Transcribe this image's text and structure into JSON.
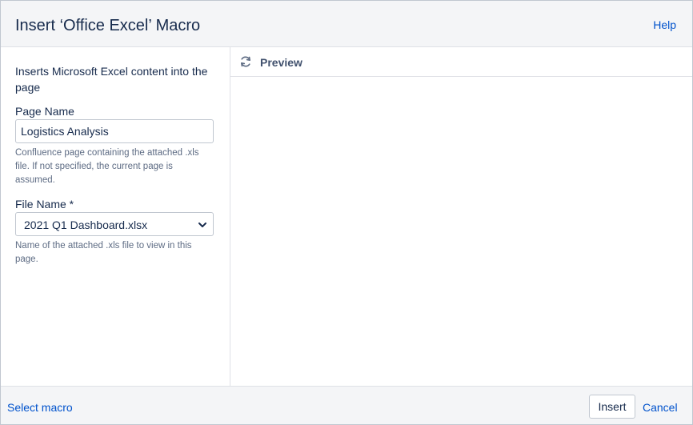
{
  "dialog": {
    "title": "Insert ‘Office Excel’ Macro",
    "help_label": "Help"
  },
  "left_panel": {
    "description": "Inserts Microsoft Excel content into the page",
    "page_name": {
      "label": "Page Name",
      "value": "Logistics Analysis",
      "help": "Confluence page containing the attached .xls file. If not specified, the current page is assumed."
    },
    "file_name": {
      "label": "File Name *",
      "value": "2021 Q1 Dashboard.xlsx",
      "help": "Name of the attached .xls file to view in this page."
    }
  },
  "preview": {
    "label": "Preview",
    "icon": "refresh-icon"
  },
  "footer": {
    "select_macro_label": "Select macro",
    "insert_label": "Insert",
    "cancel_label": "Cancel"
  },
  "colors": {
    "link": "#0052cc",
    "text": "#172b4d",
    "subtle_text": "#5e6c84",
    "header_bg": "#f4f5f7",
    "border": "#c1c7d0"
  }
}
